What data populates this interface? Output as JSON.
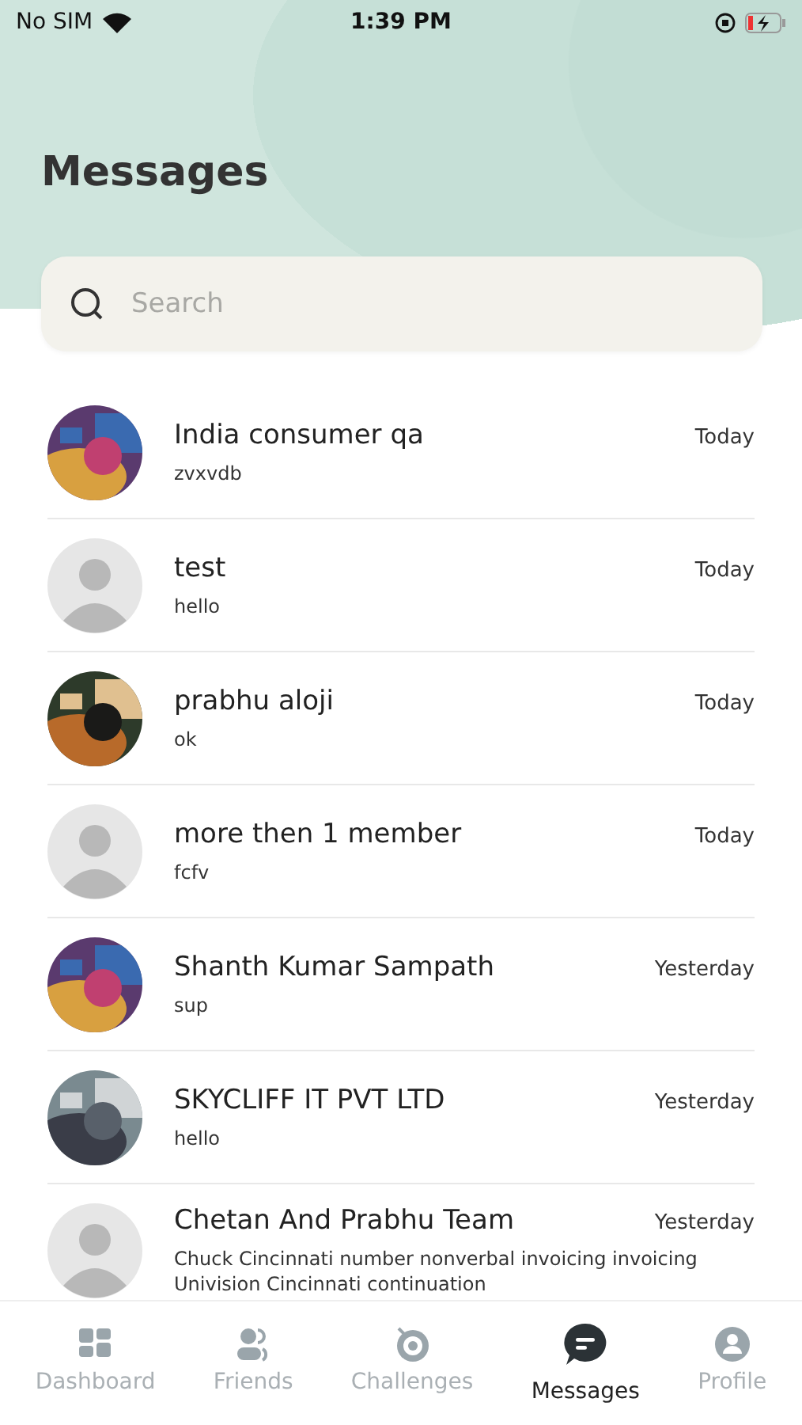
{
  "status_bar": {
    "carrier": "No SIM",
    "time": "1:39 PM"
  },
  "title": "Messages",
  "search": {
    "placeholder": "Search"
  },
  "conversations": [
    {
      "name": "India consumer qa",
      "message": "zvxvdb",
      "time": "Today"
    },
    {
      "name": "test",
      "message": "hello",
      "time": "Today",
      "avatar": {
        "kind": "placeholder"
      }
    },
    {
      "name": "prabhu aloji",
      "message": "ok",
      "time": "Today"
    },
    {
      "name": "more then 1 member",
      "message": "fcfv",
      "time": "Today",
      "avatar": {
        "kind": "placeholder"
      }
    },
    {
      "name": "Shanth Kumar Sampath",
      "message": "sup",
      "time": "Yesterday"
    },
    {
      "name": "SKYCLIFF IT PVT LTD",
      "message": "hello",
      "time": "Yesterday"
    },
    {
      "name": "Chetan And Prabhu Team",
      "message": "Chuck Cincinnati number nonverbal invoicing invoicing Univision Cincinnati continuation",
      "time": "Yesterday",
      "avatar": {
        "kind": "placeholder"
      }
    }
  ],
  "tabs": [
    {
      "label": "Dashboard",
      "kind": "dashboard",
      "selected": false
    },
    {
      "label": "Friends",
      "kind": "friends",
      "selected": false
    },
    {
      "label": "Challenges",
      "kind": "challenges",
      "selected": false
    },
    {
      "label": "Messages",
      "kind": "messages",
      "selected": true
    },
    {
      "label": "Profile",
      "kind": "profile",
      "selected": false
    }
  ]
}
